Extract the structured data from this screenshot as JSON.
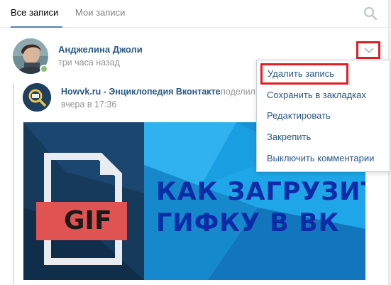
{
  "tabs": [
    {
      "label": "Все записи",
      "active": true
    },
    {
      "label": "Мои записи",
      "active": false
    }
  ],
  "search": {
    "icon": "search-icon"
  },
  "post": {
    "author": "Анджелина Джоли",
    "time": "три часа назад",
    "online": true,
    "menu_toggle_icon": "chevron-down-icon"
  },
  "repost": {
    "source": "Howvk.ru - Энциклопедия Вконтакте",
    "action": "поделил",
    "time": "вчера в 17:36"
  },
  "banner": {
    "badge": "GIF",
    "title_line1": "КАК ЗАГРУЗИТЬ",
    "title_line2": "ГИФКУ В ВК"
  },
  "menu": {
    "items": [
      {
        "label": "Удалить запись",
        "highlighted": true
      },
      {
        "label": "Сохранить в закладках"
      },
      {
        "label": "Редактировать"
      },
      {
        "label": "Закрепить"
      },
      {
        "label": "Выключить комментарии"
      }
    ]
  },
  "colors": {
    "link": "#2a5885",
    "muted": "#939393",
    "accent": "#5181b8",
    "highlight_border": "#e31e24",
    "online": "#8ac176"
  }
}
